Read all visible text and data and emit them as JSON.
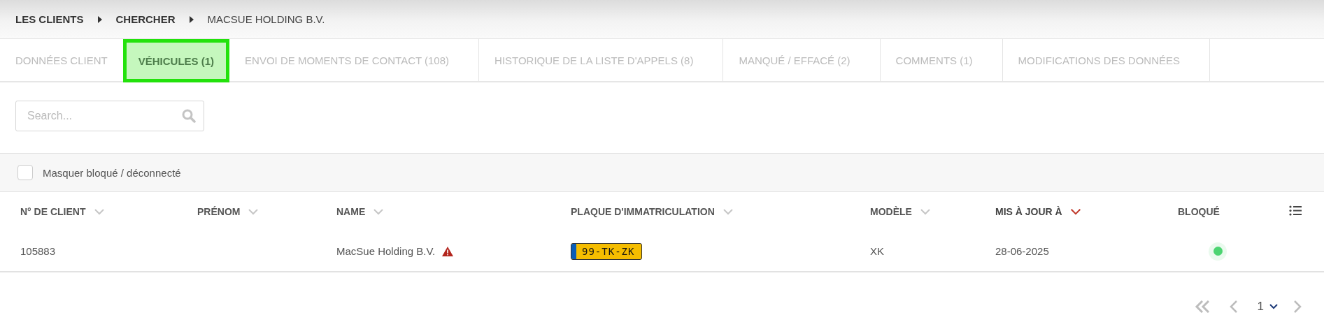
{
  "breadcrumb": [
    {
      "label": "LES CLIENTS",
      "current": false
    },
    {
      "label": "CHERCHER",
      "current": false
    },
    {
      "label": "MACSUE HOLDING B.V.",
      "current": true
    }
  ],
  "tabs": [
    {
      "label": "DONNÉES CLIENT",
      "selected": false
    },
    {
      "label": "VÉHICULES (1)",
      "selected": true
    },
    {
      "label": "ENVOI DE MOMENTS DE CONTACT (108)",
      "selected": false
    },
    {
      "label": "HISTORIQUE DE LA LISTE D'APPELS (8)",
      "selected": false
    },
    {
      "label": "MANQUÉ / EFFACÉ (2)",
      "selected": false
    },
    {
      "label": "COMMENTS (1)",
      "selected": false
    },
    {
      "label": "MODIFICATIONS DES DONNÉES",
      "selected": false
    }
  ],
  "search": {
    "placeholder": "Search..."
  },
  "filter": {
    "label": "Masquer bloqué / déconnecté",
    "checked": false
  },
  "table": {
    "columns": [
      {
        "label": "N° DE CLIENT",
        "kind": "sortable",
        "sorted": false
      },
      {
        "label": "PRÉNOM",
        "kind": "sortable",
        "sorted": false
      },
      {
        "label": "NAME",
        "kind": "sortable",
        "sorted": false
      },
      {
        "label": "PLAQUE D'IMMATRICULATION",
        "kind": "sortable",
        "sorted": false
      },
      {
        "label": "MODÈLE",
        "kind": "sortable",
        "sorted": false
      },
      {
        "label": "MIS À JOUR À",
        "kind": "sortable",
        "sorted": true
      },
      {
        "label": "BLOQUÉ",
        "kind": "plain"
      }
    ],
    "rows": [
      {
        "client_no": "105883",
        "name": "MacSue Holding B.V.",
        "warning": true,
        "plate": "99-TK-ZK",
        "model": "XK",
        "updated": "28-06-2025",
        "blocked": false
      }
    ]
  },
  "pager": {
    "page": "1"
  }
}
